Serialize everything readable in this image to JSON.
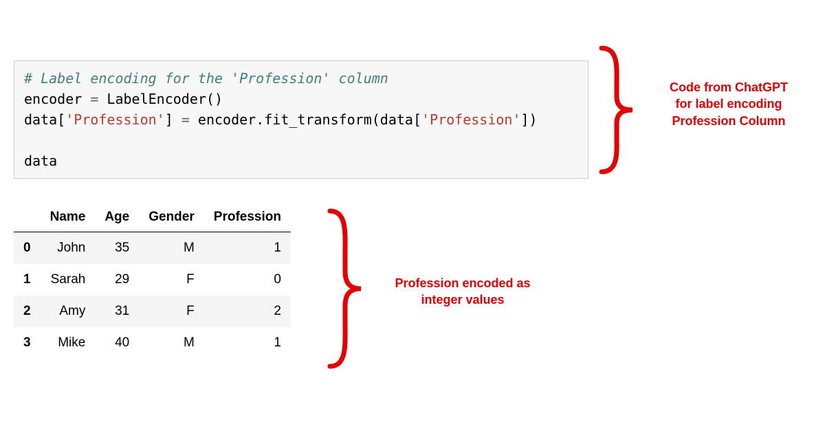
{
  "code": {
    "line1_comment": "# Label encoding for the 'Profession' column",
    "line2_a": "encoder ",
    "line2_eq": "= ",
    "line2_b": "LabelEncoder()",
    "line3_a": "data[",
    "line3_s1": "'Profession'",
    "line3_b": "] ",
    "line3_eq": "= ",
    "line3_c": "encoder.fit_transform(data[",
    "line3_s2": "'Profession'",
    "line3_d": "])",
    "line5": "data"
  },
  "table": {
    "headers": {
      "name": "Name",
      "age": "Age",
      "gender": "Gender",
      "profession": "Profession"
    },
    "rows": [
      {
        "idx": "0",
        "name": "John",
        "age": "35",
        "gender": "M",
        "profession": "1"
      },
      {
        "idx": "1",
        "name": "Sarah",
        "age": "29",
        "gender": "F",
        "profession": "0"
      },
      {
        "idx": "2",
        "name": "Amy",
        "age": "31",
        "gender": "F",
        "profession": "2"
      },
      {
        "idx": "3",
        "name": "Mike",
        "age": "40",
        "gender": "M",
        "profession": "1"
      }
    ]
  },
  "annotations": {
    "right_l1": "Code from ChatGPT",
    "right_l2": "for label encoding",
    "right_l3": "Profession Column",
    "center_l1": "Profession encoded as",
    "center_l2": "integer values"
  },
  "chart_data": {
    "type": "table",
    "headers": [
      "",
      "Name",
      "Age",
      "Gender",
      "Profession"
    ],
    "rows": [
      [
        "0",
        "John",
        35,
        "M",
        1
      ],
      [
        "1",
        "Sarah",
        29,
        "F",
        0
      ],
      [
        "2",
        "Amy",
        31,
        "F",
        2
      ],
      [
        "3",
        "Mike",
        40,
        "M",
        1
      ]
    ]
  }
}
